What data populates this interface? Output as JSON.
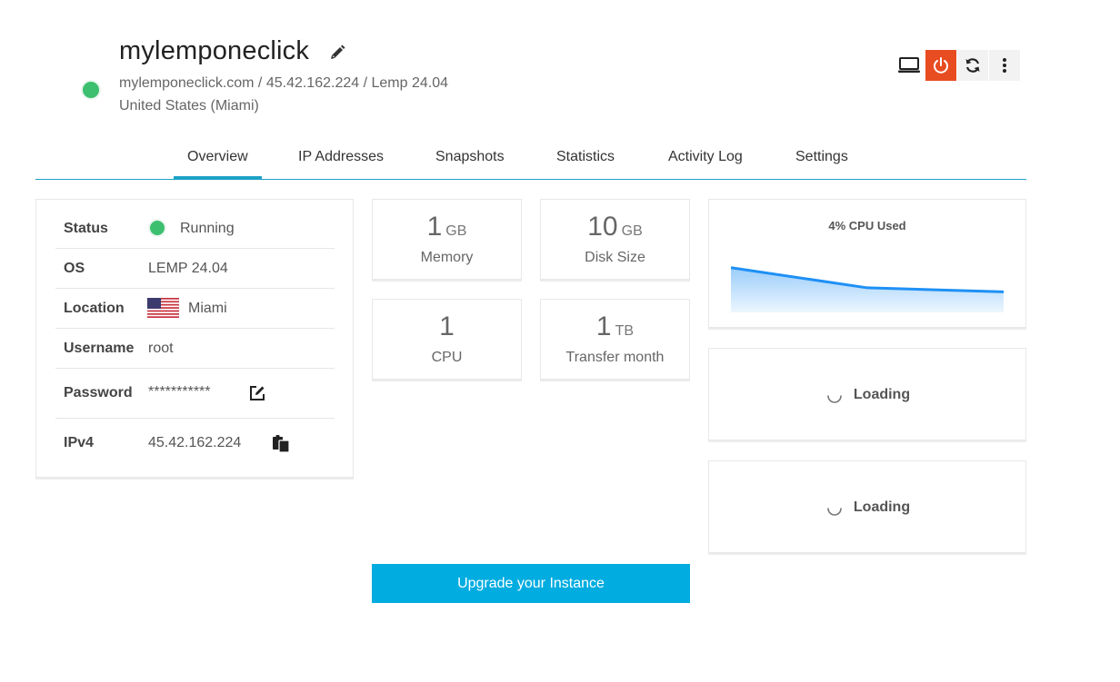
{
  "instance": {
    "name": "mylemponeclick",
    "status_color": "#3cbf6e",
    "subtitle": "mylemponeclick.com / 45.42.162.224 / Lemp 24.04",
    "location": "United States (Miami)"
  },
  "actions": [
    {
      "icon": "monitor-icon"
    },
    {
      "icon": "power-icon",
      "color": "#e84c21"
    },
    {
      "icon": "refresh-icon"
    },
    {
      "icon": "more-vertical-icon"
    }
  ],
  "tabs": [
    {
      "label": "Overview",
      "active": true
    },
    {
      "label": "IP Addresses"
    },
    {
      "label": "Snapshots"
    },
    {
      "label": "Statistics"
    },
    {
      "label": "Activity Log"
    },
    {
      "label": "Settings"
    }
  ],
  "info": {
    "status": {
      "label": "Status",
      "value": "Running"
    },
    "os": {
      "label": "OS",
      "value": "LEMP 24.04"
    },
    "location": {
      "label": "Location",
      "value": "Miami",
      "flag": "us-flag-icon"
    },
    "username": {
      "label": "Username",
      "value": "root"
    },
    "password": {
      "label": "Password",
      "value": "***********"
    },
    "ipv4": {
      "label": "IPv4",
      "value": "45.42.162.224"
    }
  },
  "stats": {
    "memory": {
      "value": "1",
      "unit": "GB",
      "label": "Memory"
    },
    "disk": {
      "value": "10",
      "unit": "GB",
      "label": "Disk Size"
    },
    "cpu": {
      "value": "1",
      "unit": "",
      "label": "CPU"
    },
    "transfer": {
      "value": "1",
      "unit": "TB",
      "label": "Transfer month"
    }
  },
  "cpu_widget": {
    "title": "4% CPU Used",
    "line_color": "#1e90f5"
  },
  "chart_data": {
    "type": "area",
    "title": "4% CPU Used",
    "x": [
      0,
      1,
      2
    ],
    "values": [
      10,
      5.5,
      4.6
    ],
    "ylim": [
      0,
      13
    ]
  },
  "loading": [
    {
      "label": "Loading"
    },
    {
      "label": "Loading"
    }
  ],
  "upgrade_label": "Upgrade your Instance"
}
